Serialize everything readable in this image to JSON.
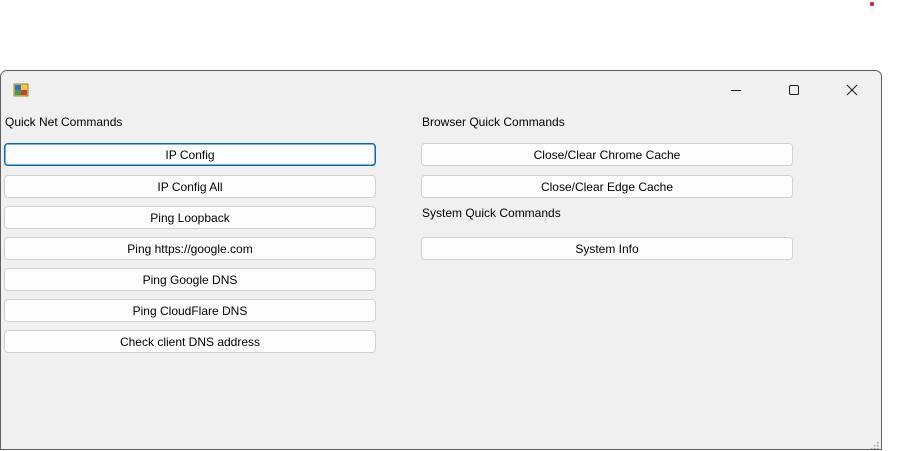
{
  "window": {
    "controls": {
      "minimize": "minimize-icon",
      "maximize": "maximize-icon",
      "close": "close-icon"
    }
  },
  "net": {
    "title": "Quick Net Commands",
    "buttons": [
      "IP Config",
      "IP Config All",
      "Ping Loopback",
      "Ping https://google.com",
      "Ping Google DNS",
      "Ping CloudFlare DNS",
      "Check client DNS address"
    ]
  },
  "browser": {
    "title": "Browser Quick Commands",
    "buttons": [
      "Close/Clear Chrome Cache",
      "Close/Clear Edge Cache"
    ]
  },
  "system": {
    "title": "System Quick Commands",
    "buttons": [
      "System Info"
    ]
  },
  "colors": {
    "focus_border": "#0067c0",
    "window_bg": "#f0f0f0"
  }
}
